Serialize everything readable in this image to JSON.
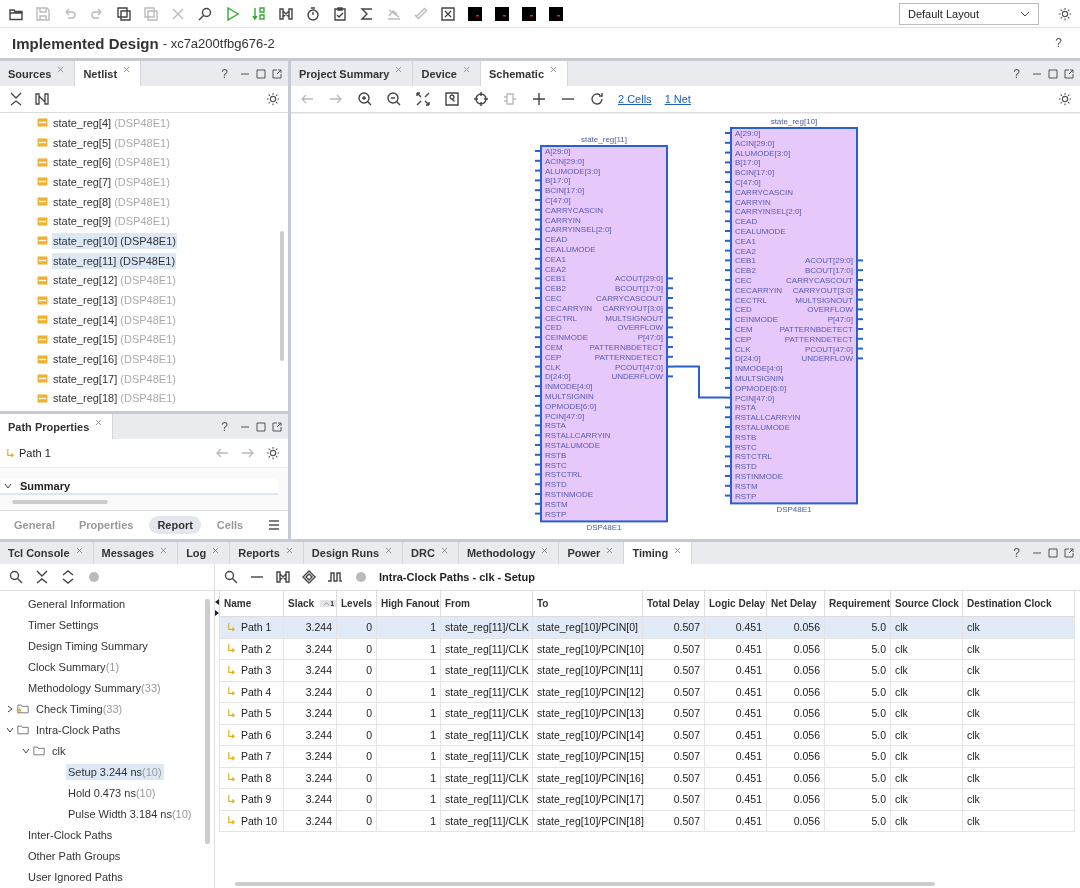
{
  "toolbar": {
    "layout_select": "Default Layout"
  },
  "header": {
    "title": "Implemented Design",
    "part": "- xc7a200tfbg676-2",
    "help": "?"
  },
  "left_panel": {
    "help": "?",
    "tabs": [
      {
        "label": "Sources",
        "selected": false
      },
      {
        "label": "Netlist",
        "selected": true
      }
    ],
    "netlist": [
      {
        "name": "state_reg[4]",
        "type": "(DSP48E1)",
        "selected": false
      },
      {
        "name": "state_reg[5]",
        "type": "(DSP48E1)",
        "selected": false
      },
      {
        "name": "state_reg[6]",
        "type": "(DSP48E1)",
        "selected": false
      },
      {
        "name": "state_reg[7]",
        "type": "(DSP48E1)",
        "selected": false
      },
      {
        "name": "state_reg[8]",
        "type": "(DSP48E1)",
        "selected": false
      },
      {
        "name": "state_reg[9]",
        "type": "(DSP48E1)",
        "selected": false
      },
      {
        "name": "state_reg[10]",
        "type": "(DSP48E1)",
        "selected": true
      },
      {
        "name": "state_reg[11]",
        "type": "(DSP48E1)",
        "selected": true
      },
      {
        "name": "state_reg[12]",
        "type": "(DSP48E1)",
        "selected": false
      },
      {
        "name": "state_reg[13]",
        "type": "(DSP48E1)",
        "selected": false
      },
      {
        "name": "state_reg[14]",
        "type": "(DSP48E1)",
        "selected": false
      },
      {
        "name": "state_reg[15]",
        "type": "(DSP48E1)",
        "selected": false
      },
      {
        "name": "state_reg[16]",
        "type": "(DSP48E1)",
        "selected": false
      },
      {
        "name": "state_reg[17]",
        "type": "(DSP48E1)",
        "selected": false
      },
      {
        "name": "state_reg[18]",
        "type": "(DSP48E1)",
        "selected": false
      }
    ]
  },
  "path_properties": {
    "title": "Path Properties",
    "help": "?",
    "path": "Path 1",
    "section": "Summary",
    "tabs": [
      {
        "label": "General",
        "selected": false
      },
      {
        "label": "Properties",
        "selected": false
      },
      {
        "label": "Report",
        "selected": true
      },
      {
        "label": "Cells",
        "selected": false
      }
    ]
  },
  "schematic_panel": {
    "help": "?",
    "tabs": [
      {
        "label": "Project Summary",
        "selected": false
      },
      {
        "label": "Device",
        "selected": false
      },
      {
        "label": "Schematic",
        "selected": true
      }
    ],
    "links": [
      "2 Cells",
      "1 Net"
    ],
    "cells": [
      {
        "name": "state_reg[11]",
        "type": "DSP48E1",
        "inputs": [
          "A[29:0]",
          "ACIN[29:0]",
          "ALUMODE[3:0]",
          "B[17:0]",
          "BCIN[17:0]",
          "C[47:0]",
          "CARRYCASCIN",
          "CARRYIN",
          "CARRYINSEL[2:0]",
          "CEAD",
          "CEALUMODE",
          "CEA1",
          "CEA2",
          "CEB1",
          "CEB2",
          "CEC",
          "CECARRYIN",
          "CECTRL",
          "CED",
          "CEINMODE",
          "CEM",
          "CEP",
          "CLK",
          "D[24:0]",
          "INMODE[4:0]",
          "MULTSIGNIN",
          "OPMODE[6:0]",
          "PCIN[47:0]",
          "RSTA",
          "RSTALLCARRYIN",
          "RSTALUMODE",
          "RSTB",
          "RSTC",
          "RSTCTRL",
          "RSTD",
          "RSTINMODE",
          "RSTM",
          "RSTP"
        ],
        "outputs": [
          "ACOUT[29:0]",
          "BCOUT[17:0]",
          "CARRYCASCOUT",
          "CARRYOUT[3:0]",
          "MULTSIGNOUT",
          "OVERFLOW",
          "P[47:0]",
          "PATTERNBDETECT",
          "PATTERNDETECT",
          "PCOUT[47:0]",
          "UNDERFLOW"
        ]
      },
      {
        "name": "state_reg[10]",
        "type": "DSP48E1",
        "inputs": [
          "A[29:0]",
          "ACIN[29:0]",
          "ALUMODE[3:0]",
          "B[17:0]",
          "BCIN[17:0]",
          "C[47:0]",
          "CARRYCASCIN",
          "CARRYIN",
          "CARRYINSEL[2:0]",
          "CEAD",
          "CEALUMODE",
          "CEA1",
          "CEA2",
          "CEB1",
          "CEB2",
          "CEC",
          "CECARRYIN",
          "CECTRL",
          "CED",
          "CEINMODE",
          "CEM",
          "CEP",
          "CLK",
          "D[24:0]",
          "INMODE[4:0]",
          "MULTSIGNIN",
          "OPMODE[6:0]",
          "PCIN[47:0]",
          "RSTA",
          "RSTALLCARRYIN",
          "RSTALUMODE",
          "RSTB",
          "RSTC",
          "RSTCTRL",
          "RSTD",
          "RSTINMODE",
          "RSTM",
          "RSTP"
        ],
        "outputs": [
          "ACOUT[29:0]",
          "BCOUT[17:0]",
          "CARRYCASCOUT",
          "CARRYOUT[3:0]",
          "MULTSIGNOUT",
          "OVERFLOW",
          "P[47:0]",
          "PATTERNBDETECT",
          "PATTERNDETECT",
          "PCOUT[47:0]",
          "UNDERFLOW"
        ]
      }
    ]
  },
  "bottom_panel": {
    "help": "?",
    "tabs": [
      {
        "label": "Tcl Console",
        "selected": false
      },
      {
        "label": "Messages",
        "selected": false
      },
      {
        "label": "Log",
        "selected": false
      },
      {
        "label": "Reports",
        "selected": false
      },
      {
        "label": "Design Runs",
        "selected": false
      },
      {
        "label": "DRC",
        "selected": false
      },
      {
        "label": "Methodology",
        "selected": false
      },
      {
        "label": "Power",
        "selected": false
      },
      {
        "label": "Timing",
        "selected": true
      }
    ],
    "tree": [
      {
        "label": "General Information",
        "kind": "leaf",
        "selected": false
      },
      {
        "label": "Timer Settings",
        "kind": "leaf",
        "selected": false
      },
      {
        "label": "Design Timing Summary",
        "kind": "leaf",
        "selected": false
      },
      {
        "label": "Clock Summary",
        "count": "(1)",
        "kind": "leaf",
        "selected": false
      },
      {
        "label": "Methodology Summary",
        "count": "(33)",
        "kind": "leaf",
        "selected": false
      },
      {
        "label": "Check Timing",
        "count": "(33)",
        "kind": "warning-folder",
        "expanded": false,
        "selected": false
      },
      {
        "label": "Intra-Clock Paths",
        "kind": "folder",
        "expanded": true,
        "selected": false,
        "children": [
          {
            "label": "clk",
            "kind": "folder",
            "expanded": true,
            "selected": false,
            "children": [
              {
                "label": "Setup 3.244 ns",
                "count": "(10)",
                "kind": "leaf",
                "selected": true
              },
              {
                "label": "Hold 0.473 ns",
                "count": "(10)",
                "kind": "leaf",
                "selected": false
              },
              {
                "label": "Pulse Width 3.184 ns",
                "count": "(10)",
                "kind": "leaf",
                "selected": false
              }
            ]
          }
        ]
      },
      {
        "label": "Inter-Clock Paths",
        "kind": "leaf",
        "selected": false
      },
      {
        "label": "Other Path Groups",
        "kind": "leaf",
        "selected": false
      },
      {
        "label": "User Ignored Paths",
        "kind": "leaf",
        "selected": false
      }
    ],
    "report_title": "Intra-Clock Paths - clk - Setup",
    "sort_indicator": "1",
    "columns": [
      "Name",
      "Slack",
      "Levels",
      "High Fanout",
      "From",
      "To",
      "Total Delay",
      "Logic Delay",
      "Net Delay",
      "Requirement",
      "Source Clock",
      "Destination Clock"
    ],
    "rows": [
      {
        "selected": true,
        "cells": [
          "Path 1",
          "3.244",
          "0",
          "1",
          "state_reg[11]/CLK",
          "state_reg[10]/PCIN[0]",
          "0.507",
          "0.451",
          "0.056",
          "5.0",
          "clk",
          "clk"
        ]
      },
      {
        "selected": false,
        "cells": [
          "Path 2",
          "3.244",
          "0",
          "1",
          "state_reg[11]/CLK",
          "state_reg[10]/PCIN[10]",
          "0.507",
          "0.451",
          "0.056",
          "5.0",
          "clk",
          "clk"
        ]
      },
      {
        "selected": false,
        "cells": [
          "Path 3",
          "3.244",
          "0",
          "1",
          "state_reg[11]/CLK",
          "state_reg[10]/PCIN[11]",
          "0.507",
          "0.451",
          "0.056",
          "5.0",
          "clk",
          "clk"
        ]
      },
      {
        "selected": false,
        "cells": [
          "Path 4",
          "3.244",
          "0",
          "1",
          "state_reg[11]/CLK",
          "state_reg[10]/PCIN[12]",
          "0.507",
          "0.451",
          "0.056",
          "5.0",
          "clk",
          "clk"
        ]
      },
      {
        "selected": false,
        "cells": [
          "Path 5",
          "3.244",
          "0",
          "1",
          "state_reg[11]/CLK",
          "state_reg[10]/PCIN[13]",
          "0.507",
          "0.451",
          "0.056",
          "5.0",
          "clk",
          "clk"
        ]
      },
      {
        "selected": false,
        "cells": [
          "Path 6",
          "3.244",
          "0",
          "1",
          "state_reg[11]/CLK",
          "state_reg[10]/PCIN[14]",
          "0.507",
          "0.451",
          "0.056",
          "5.0",
          "clk",
          "clk"
        ]
      },
      {
        "selected": false,
        "cells": [
          "Path 7",
          "3.244",
          "0",
          "1",
          "state_reg[11]/CLK",
          "state_reg[10]/PCIN[15]",
          "0.507",
          "0.451",
          "0.056",
          "5.0",
          "clk",
          "clk"
        ]
      },
      {
        "selected": false,
        "cells": [
          "Path 8",
          "3.244",
          "0",
          "1",
          "state_reg[11]/CLK",
          "state_reg[10]/PCIN[16]",
          "0.507",
          "0.451",
          "0.056",
          "5.0",
          "clk",
          "clk"
        ]
      },
      {
        "selected": false,
        "cells": [
          "Path 9",
          "3.244",
          "0",
          "1",
          "state_reg[11]/CLK",
          "state_reg[10]/PCIN[17]",
          "0.507",
          "0.451",
          "0.056",
          "5.0",
          "clk",
          "clk"
        ]
      },
      {
        "selected": false,
        "cells": [
          "Path 10",
          "3.244",
          "0",
          "1",
          "state_reg[11]/CLK",
          "state_reg[10]/PCIN[18]",
          "0.507",
          "0.451",
          "0.056",
          "5.0",
          "clk",
          "clk"
        ]
      }
    ]
  }
}
